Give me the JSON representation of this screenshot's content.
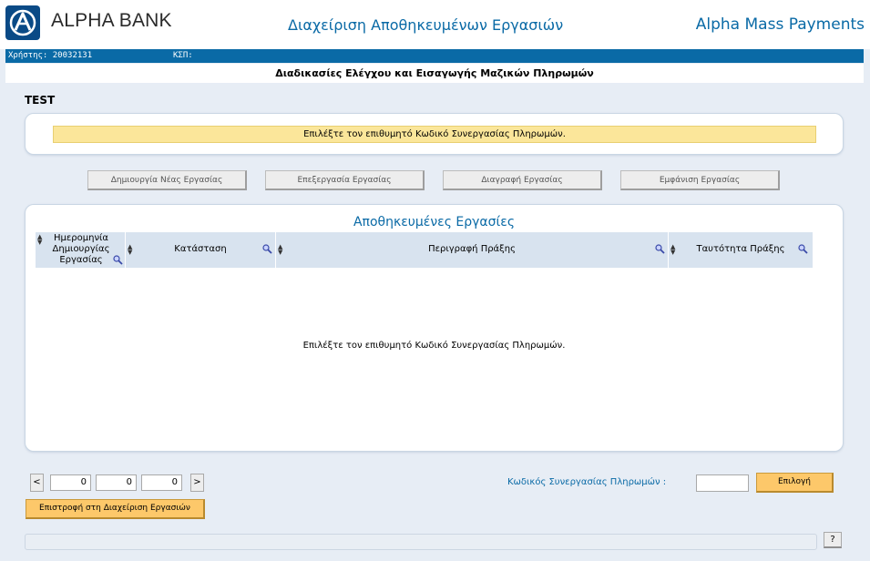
{
  "header": {
    "logo_text": "ALPHA BANK",
    "center_title": "Διαχείριση Αποθηκευμένων Εργασιών",
    "right_title": "Alpha Mass Payments"
  },
  "userbar": {
    "user": "Χρήστης: 20032131",
    "ksp": "ΚΣΠ:"
  },
  "subtitle": "Διαδικασίες Ελέγχου και Εισαγωγής Μαζικών Πληρωμών",
  "test_label": "TEST",
  "notice": "Επιλέξτε τον επιθυμητό Κωδικό Συνεργασίας Πληρωμών.",
  "actions": {
    "create": "Δημιουργία Νέας Εργασίας",
    "edit": "Επεξεργασία Εργασίας",
    "delete": "Διαγραφή Εργασίας",
    "view": "Εμφάνιση Εργασίας"
  },
  "table": {
    "title": "Αποθηκευμένες Εργασίες",
    "columns": [
      "Ημερομηνία Δημιουργίας Εργασίας",
      "Κατάσταση",
      "Περιγραφή Πράξης",
      "Ταυτότητα Πράξης"
    ],
    "empty_message": "Επιλέξτε τον επιθυμητό Κωδικό Συνεργασίας Πληρωμών."
  },
  "pager": {
    "prev": "<",
    "next": ">",
    "field1": "0",
    "field2": "0",
    "field3": "0"
  },
  "code": {
    "label": "Κωδικός Συνεργασίας Πληρωμών :",
    "value": "",
    "select_button": "Επιλογή"
  },
  "back_button": "Επιστροφή στη Διαχείριση Εργασιών",
  "help_button": "?",
  "colors": {
    "brand_blue": "#0a6aa6",
    "notice_yellow": "#fbe69a",
    "button_orange": "#fdc86a"
  }
}
